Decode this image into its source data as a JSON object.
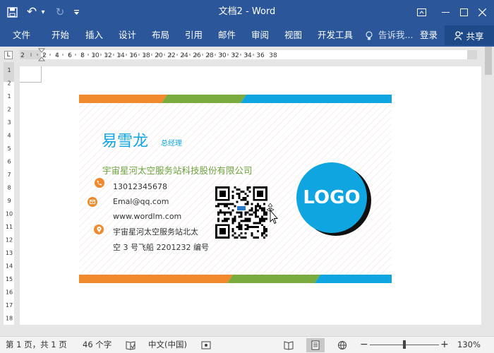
{
  "titlebar": {
    "title": "文档2 - Word",
    "undo_glyph": "↶",
    "redo_glyph": "↻",
    "dropdown_glyph": "▾"
  },
  "ribbon": {
    "tabs": [
      "文件",
      "开始",
      "插入",
      "设计",
      "布局",
      "引用",
      "邮件",
      "审阅",
      "视图",
      "开发工具"
    ],
    "tell_me": "告诉我...",
    "login": "登录",
    "share": "共享"
  },
  "ruler": {
    "corner_label": "L",
    "top_numbers": [
      "2",
      "2",
      "4",
      "6",
      "8",
      "10",
      "12",
      "14",
      "16",
      "18",
      "20",
      "22",
      "24",
      "26",
      "28",
      "30",
      "32",
      "34",
      "36",
      "38"
    ],
    "left_numbers": [
      "1",
      "2",
      "1",
      "2",
      "3",
      "4",
      "5",
      "6",
      "7",
      "8",
      "9",
      "10",
      "11",
      "12",
      "13",
      "14",
      "15",
      "16",
      "17",
      "18"
    ]
  },
  "card": {
    "name": "易雪龙",
    "job_title": "总经理",
    "company": "宇宙星河太空服务站科技股份有限公司",
    "phone": "13012345678",
    "email": "Emal@qq.com",
    "website": "www.wordlm.com",
    "address_line1": "宇宙星河太空服务站北太",
    "address_line2": "空 3 号飞船 2201232 编号",
    "logo_text": "LOGO",
    "colors": {
      "orange": "#f08a2c",
      "green": "#7aab3e",
      "blue": "#0fa5e0",
      "name_blue": "#0fa5e0",
      "company_green": "#6ca33d"
    }
  },
  "statusbar": {
    "page_info": "第 1 页，共 1 页",
    "word_count": "46 个字",
    "language": "中文(中国)",
    "zoom": "130%",
    "zoom_minus": "−",
    "zoom_plus": "+"
  }
}
